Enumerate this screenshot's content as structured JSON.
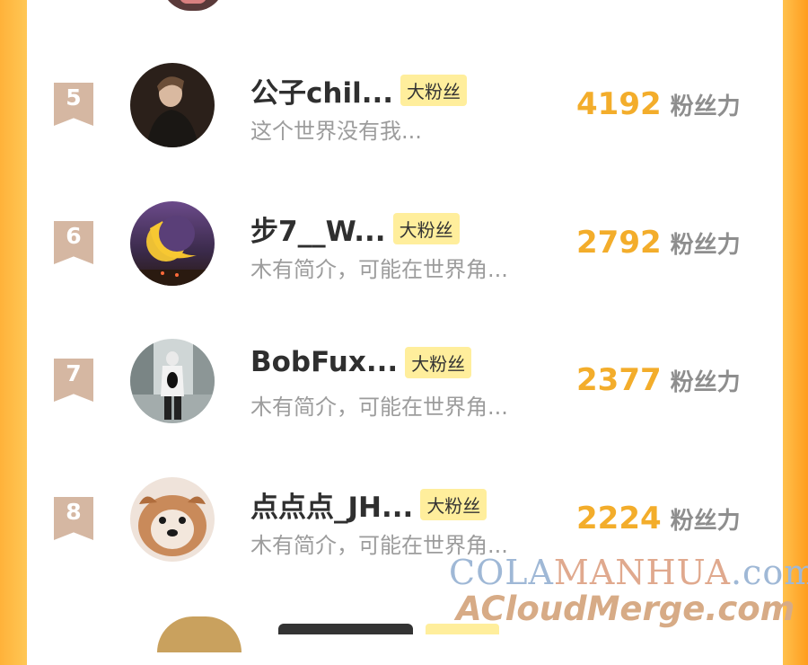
{
  "badge_label": "大粉丝",
  "power_unit": "粉丝力",
  "rows": [
    {
      "rank": "5",
      "name": "公子chil...",
      "bio": "这个世界没有我...",
      "power": "4192"
    },
    {
      "rank": "6",
      "name": "步7__W...",
      "bio": "木有简介，可能在世界角...",
      "power": "2792"
    },
    {
      "rank": "7",
      "name": "BobFux...",
      "bio": "木有简介，可能在世界角...",
      "power": "2377"
    },
    {
      "rank": "8",
      "name": "点点点_JH...",
      "bio": "木有简介，可能在世界角...",
      "power": "2224"
    }
  ],
  "watermark": {
    "line1_part1": "COLA",
    "line1_part2": "MANHUA",
    "line1_part3": ".com",
    "line2": "ACloudMerge.com"
  }
}
